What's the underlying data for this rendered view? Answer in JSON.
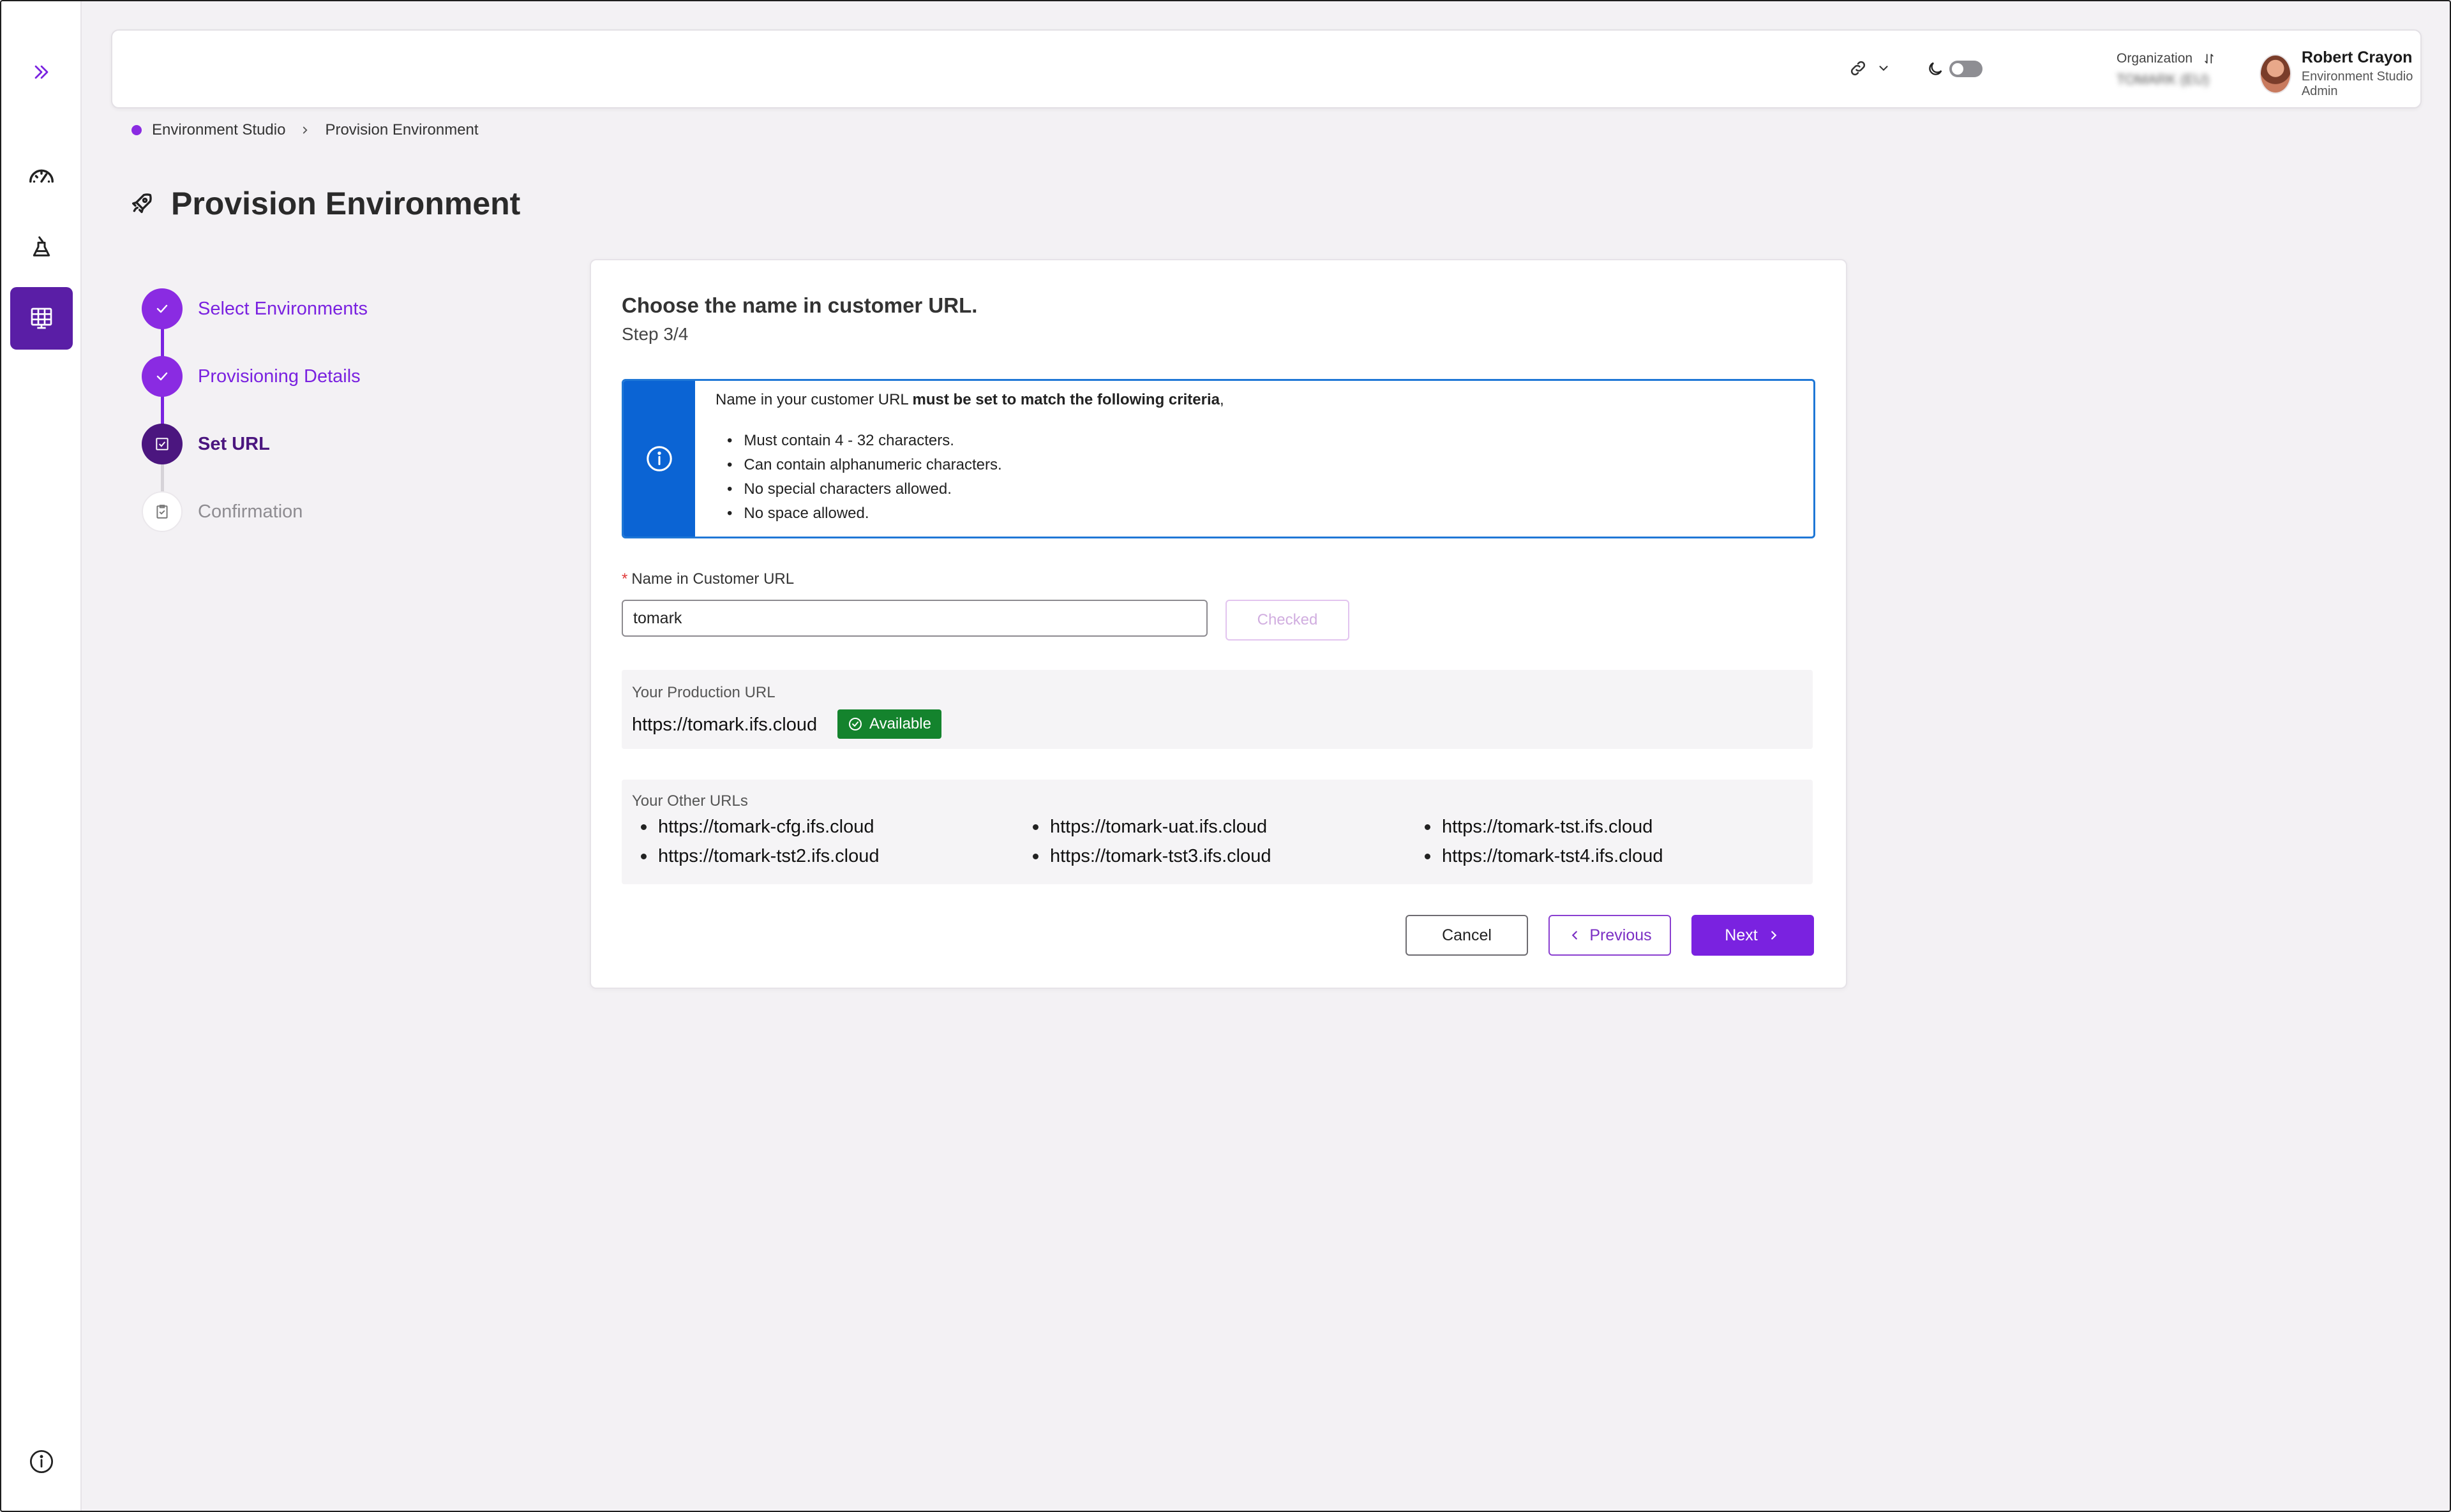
{
  "sidebar": {
    "items": [
      {
        "icon": "chevrons-right-icon"
      },
      {
        "icon": "speedometer-icon"
      },
      {
        "icon": "environment-flask-icon"
      },
      {
        "icon": "provision-grid-icon",
        "active": true
      },
      {
        "icon": "info-icon"
      }
    ]
  },
  "header": {
    "link_icon": "link-icon",
    "theme_icon": "moon-icon",
    "org_label": "Organization",
    "org_value": "TOMARK (EU)",
    "user_name": "Robert Crayon",
    "user_role": "Environment Studio Admin"
  },
  "breadcrumb": {
    "root": "Environment Studio",
    "current": "Provision Environment"
  },
  "page": {
    "title": "Provision Environment",
    "title_icon": "rocket-icon"
  },
  "stepper": {
    "steps": [
      {
        "label": "Select Environments",
        "state": "done"
      },
      {
        "label": "Provisioning Details",
        "state": "done"
      },
      {
        "label": "Set URL",
        "state": "current"
      },
      {
        "label": "Confirmation",
        "state": "pending"
      }
    ]
  },
  "card": {
    "title": "Choose the name in customer URL.",
    "step": "Step 3/4",
    "info": {
      "intro": "Name in your customer URL ",
      "intro_bold": "must be set to match the following criteria",
      "intro_end": ",",
      "criteria": [
        "Must contain 4 - 32 characters.",
        "Can contain alphanumeric characters.",
        "No special characters allowed.",
        "No space allowed."
      ]
    },
    "field_label": "Name in Customer URL",
    "field_value": "tomark",
    "check_button": "Checked",
    "production": {
      "label": "Your Production URL",
      "url": "https://tomark.ifs.cloud",
      "badge": "Available"
    },
    "other": {
      "label": "Your Other URLs",
      "urls": [
        "https://tomark-cfg.ifs.cloud",
        "https://tomark-uat.ifs.cloud",
        "https://tomark-tst.ifs.cloud",
        "https://tomark-tst2.ifs.cloud",
        "https://tomark-tst3.ifs.cloud",
        "https://tomark-tst4.ifs.cloud"
      ]
    },
    "buttons": {
      "cancel": "Cancel",
      "previous": "Previous",
      "next": "Next"
    }
  },
  "colors": {
    "accent": "#7a22e0",
    "accent_dark": "#5a1ea6",
    "info_blue": "#0b64d4",
    "success": "#14832d"
  }
}
